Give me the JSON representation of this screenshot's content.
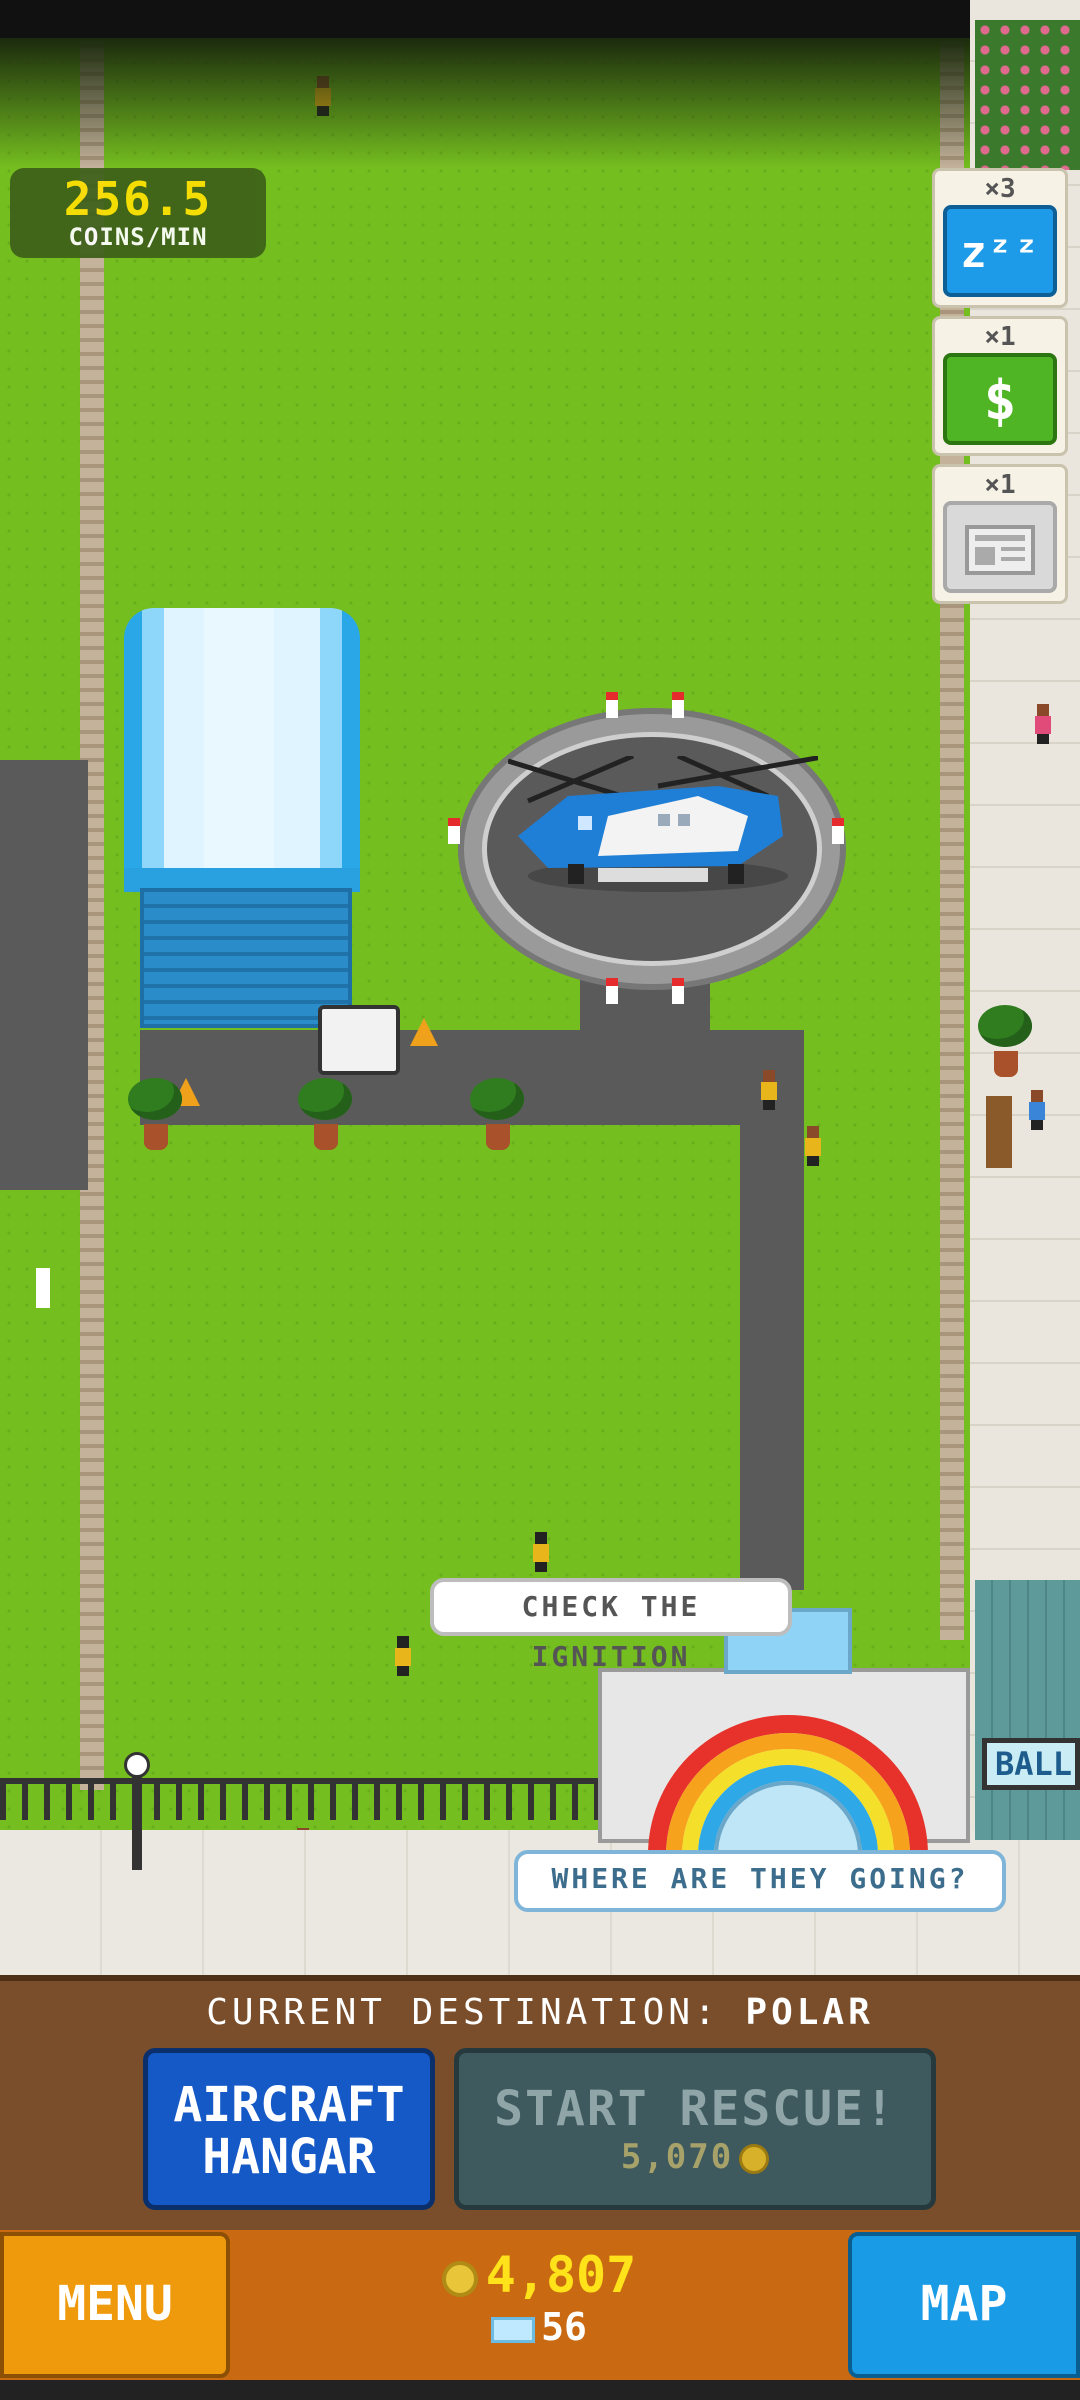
{
  "hud": {
    "coin_rate_value": "256.5",
    "coin_rate_label": "COINS/MIN"
  },
  "boosts": [
    {
      "count": "×3",
      "symbol": "zᶻᶻ",
      "icon": "sleep-icon",
      "color": "#1e9be8"
    },
    {
      "count": "×1",
      "symbol": "$",
      "icon": "dollar-icon",
      "color": "#4fb524"
    },
    {
      "count": "×1",
      "symbol": "",
      "icon": "newspaper-icon",
      "color": "#d9d9d9"
    }
  ],
  "speech": {
    "ignition": "CHECK THE IGNITION",
    "where": "WHERE ARE THEY GOING?"
  },
  "signs": {
    "ball": "BALL"
  },
  "panel": {
    "destination_label": "CURRENT DESTINATION:",
    "destination_value": "POLAR",
    "hangar_line1": "AIRCRAFT",
    "hangar_line2": "HANGAR",
    "rescue_label": "START RESCUE!",
    "rescue_price": "5,070"
  },
  "bottom_bar": {
    "menu_label": "MENU",
    "map_label": "MAP",
    "coins": "4,807",
    "gems": "56"
  },
  "colors": {
    "grass": "#74be20",
    "coin_yellow": "#ffe21a",
    "hangar_button": "#1559c7",
    "menu_button": "#ef9a0c",
    "map_button": "#1a9be6"
  }
}
